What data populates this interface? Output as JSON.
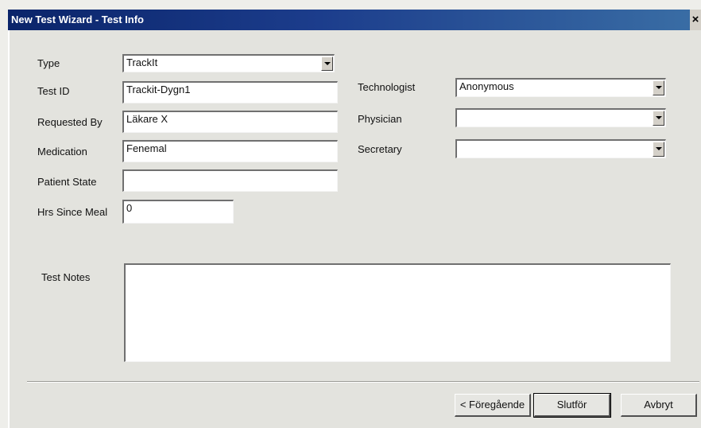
{
  "window": {
    "title": "New Test Wizard - Test Info",
    "close": "×"
  },
  "fields": {
    "type": {
      "label": "Type",
      "value": "TrackIt"
    },
    "test_id": {
      "label": "Test ID",
      "value": "Trackit-Dygn1"
    },
    "requested_by": {
      "label": "Requested By",
      "value": "Läkare X"
    },
    "medication": {
      "label": "Medication",
      "value": "Fenemal"
    },
    "patient_state": {
      "label": "Patient State",
      "value": ""
    },
    "hrs_since_meal": {
      "label": "Hrs Since Meal",
      "value": "0"
    },
    "technologist": {
      "label": "Technologist",
      "value": "Anonymous"
    },
    "physician": {
      "label": "Physician",
      "value": ""
    },
    "secretary": {
      "label": "Secretary",
      "value": ""
    },
    "test_notes": {
      "label": "Test Notes",
      "value": ""
    }
  },
  "buttons": {
    "back": "< Föregående",
    "finish": "Slutför",
    "cancel": "Avbryt"
  }
}
